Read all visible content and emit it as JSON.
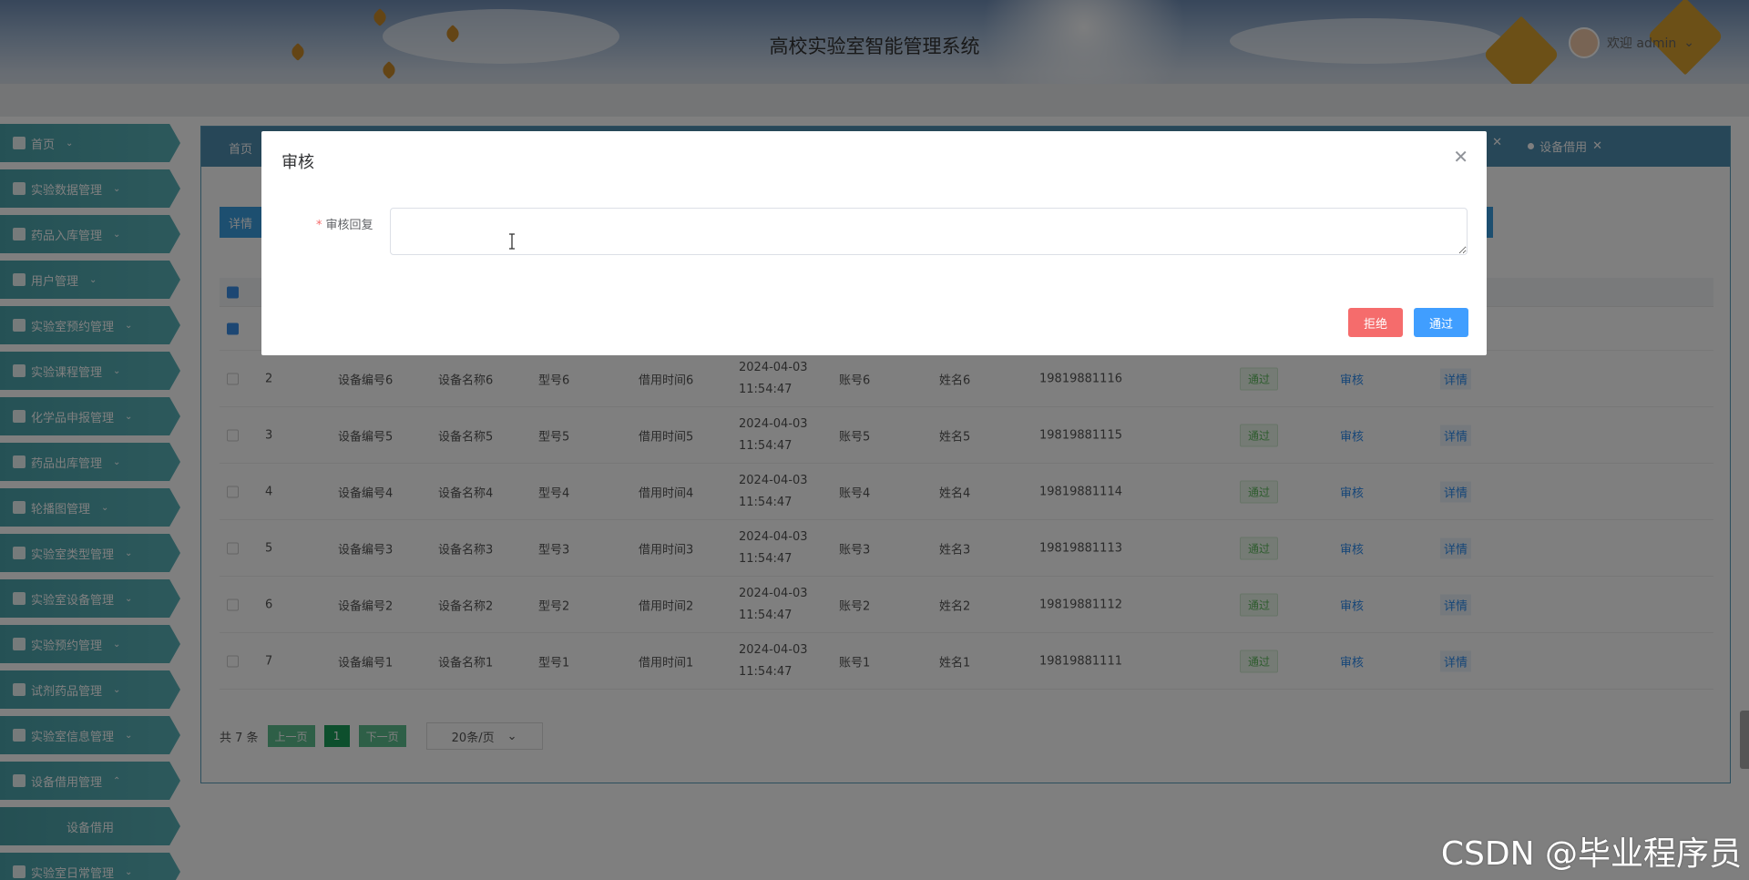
{
  "header": {
    "title": "高校实验室智能管理系统",
    "welcome": "欢迎 admin"
  },
  "sidebar": {
    "items": [
      {
        "label": "首页"
      },
      {
        "label": "实验数据管理"
      },
      {
        "label": "药品入库管理"
      },
      {
        "label": "用户管理"
      },
      {
        "label": "实验室预约管理"
      },
      {
        "label": "实验课程管理"
      },
      {
        "label": "化学品申报管理"
      },
      {
        "label": "药品出库管理"
      },
      {
        "label": "轮播图管理"
      },
      {
        "label": "实验室类型管理"
      },
      {
        "label": "实验室设备管理"
      },
      {
        "label": "实验预约管理"
      },
      {
        "label": "试剂药品管理"
      },
      {
        "label": "实验室信息管理"
      },
      {
        "label": "设备借用管理"
      },
      {
        "label": "设备借用"
      },
      {
        "label": "实验室日常管理"
      }
    ]
  },
  "tabs": {
    "home": "首页",
    "active": "设备借用"
  },
  "toolbar": {
    "detail_label": "详情"
  },
  "table": {
    "rows": [
      {
        "idx": "2",
        "code": "设备编号6",
        "name": "设备名称6",
        "model": "型号6",
        "borrow": "借用时间6",
        "time": "2024-04-03 11:54:47",
        "account": "账号6",
        "person": "姓名6",
        "phone": "19819881116",
        "status": "通过",
        "audit": "审核",
        "detail": "详情"
      },
      {
        "idx": "3",
        "code": "设备编号5",
        "name": "设备名称5",
        "model": "型号5",
        "borrow": "借用时间5",
        "time": "2024-04-03 11:54:47",
        "account": "账号5",
        "person": "姓名5",
        "phone": "19819881115",
        "status": "通过",
        "audit": "审核",
        "detail": "详情"
      },
      {
        "idx": "4",
        "code": "设备编号4",
        "name": "设备名称4",
        "model": "型号4",
        "borrow": "借用时间4",
        "time": "2024-04-03 11:54:47",
        "account": "账号4",
        "person": "姓名4",
        "phone": "19819881114",
        "status": "通过",
        "audit": "审核",
        "detail": "详情"
      },
      {
        "idx": "5",
        "code": "设备编号3",
        "name": "设备名称3",
        "model": "型号3",
        "borrow": "借用时间3",
        "time": "2024-04-03 11:54:47",
        "account": "账号3",
        "person": "姓名3",
        "phone": "19819881113",
        "status": "通过",
        "audit": "审核",
        "detail": "详情"
      },
      {
        "idx": "6",
        "code": "设备编号2",
        "name": "设备名称2",
        "model": "型号2",
        "borrow": "借用时间2",
        "time": "2024-04-03 11:54:47",
        "account": "账号2",
        "person": "姓名2",
        "phone": "19819881112",
        "status": "通过",
        "audit": "审核",
        "detail": "详情"
      },
      {
        "idx": "7",
        "code": "设备编号1",
        "name": "设备名称1",
        "model": "型号1",
        "borrow": "借用时间1",
        "time": "2024-04-03 11:54:47",
        "account": "账号1",
        "person": "姓名1",
        "phone": "19819881111",
        "status": "通过",
        "audit": "审核",
        "detail": "详情"
      }
    ]
  },
  "pager": {
    "total": "共 7 条",
    "prev": "上一页",
    "page": "1",
    "next": "下一页",
    "size": "20条/页"
  },
  "dialog": {
    "title": "审核",
    "label": "审核回复",
    "required_mark": "*",
    "reject": "拒绝",
    "pass": "通过"
  },
  "watermark": "CSDN @毕业程序员",
  "colors": {
    "sidebar": "#4ba3ab",
    "tabbar": "#4f8eb0",
    "reject": "#f56c6c",
    "pass": "#409eff",
    "status": "#5cb85c"
  }
}
